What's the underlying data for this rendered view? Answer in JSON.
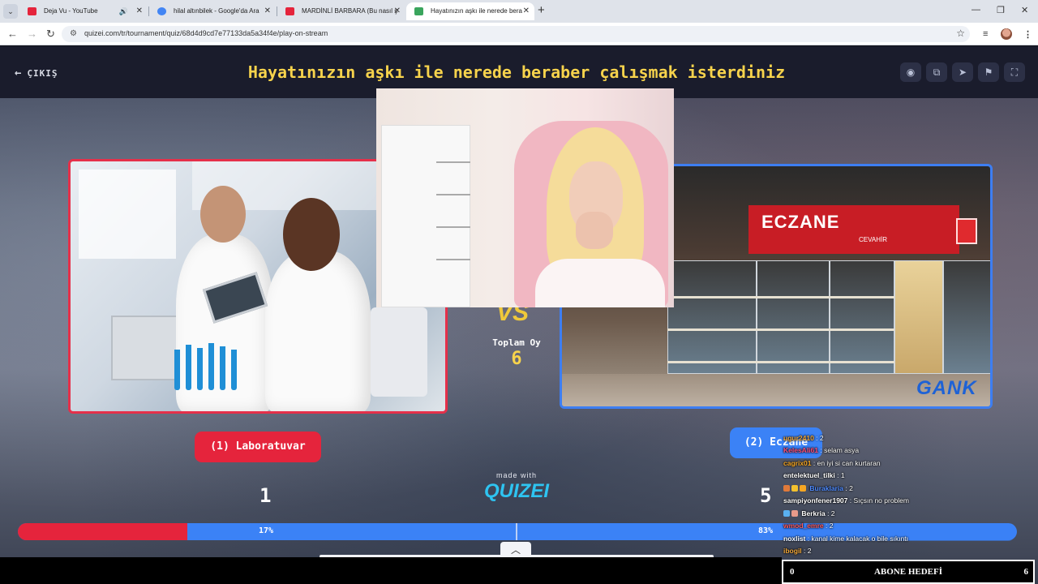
{
  "browser": {
    "tabs": [
      {
        "title": "Deja Vu - YouTube",
        "favicon_color": "#e5243c",
        "audio": true
      },
      {
        "title": "hilal altınbilek - Google'da Ara",
        "favicon_color": "#4285f4"
      },
      {
        "title": "MARDİNLİ BARBARA (Bu nasıl ş",
        "favicon_color": "#e5243c"
      },
      {
        "title": "Hayatınızın aşkı ile nerede bera",
        "favicon_color": "#3aa55d",
        "active": true
      }
    ],
    "url": "quizei.com/tr/tournament/quiz/68d4d9cd7e77133da5a34f4e/play-on-stream"
  },
  "header": {
    "back_label": "ÇIKIŞ",
    "title": "Hayatınızın aşkı ile nerede beraber çalışmak isterdiniz",
    "icons": [
      "eye-icon",
      "share-icon",
      "send-icon",
      "flag-icon",
      "fullscreen-icon"
    ]
  },
  "choices": [
    {
      "label": "(1) Laboratuvar",
      "votes": "1",
      "percent": "17%",
      "share": 0.17,
      "color": "#e5243c"
    },
    {
      "label": "(2) Eczane",
      "votes": "5",
      "percent": "83%",
      "share": 0.83,
      "color": "#3b82f6"
    }
  ],
  "center": {
    "vs": "VS",
    "total_label": "Toplam Oy",
    "total_value": "6",
    "made_with": "made with",
    "brand": "QUIZEI"
  },
  "pharmacy_sign": {
    "main": "ECZANE",
    "sub": "CEVAHİR"
  },
  "watermark": "GANK",
  "chat": [
    {
      "user": "ugur2410",
      "text": ": 2",
      "color": "#f0a73a"
    },
    {
      "user": "KelesAli61",
      "text": ": selam asya",
      "color": "#ff4f7a"
    },
    {
      "user": "cagrix01",
      "text": ": en iyi si can kurtaran",
      "color": "#f5a623"
    },
    {
      "user": "entelektuel_tilki",
      "text": ": 1",
      "color": "#ffffff"
    },
    {
      "user": "Buraklaria",
      "text": ": 2",
      "color": "#4f8bff",
      "badges": 3
    },
    {
      "user": "sampiyonfener1907",
      "text": ": Sıçsın no problem",
      "color": "#ffffff"
    },
    {
      "user": "Berkria",
      "text": ": 2",
      "color": "#ffffff",
      "badges": 2
    },
    {
      "user": "wmod_emre",
      "text": ": 2",
      "color": "#ff5c5c"
    },
    {
      "user": "noxlist",
      "text": ": kanal kime kalacak o bile sıkıntı",
      "color": "#ffffff"
    },
    {
      "user": "ibogil",
      "text": ": 2",
      "color": "#f0a73a"
    }
  ],
  "subscriber_goal": {
    "current": "0",
    "label": "ABONE HEDEFİ",
    "target": "6"
  }
}
